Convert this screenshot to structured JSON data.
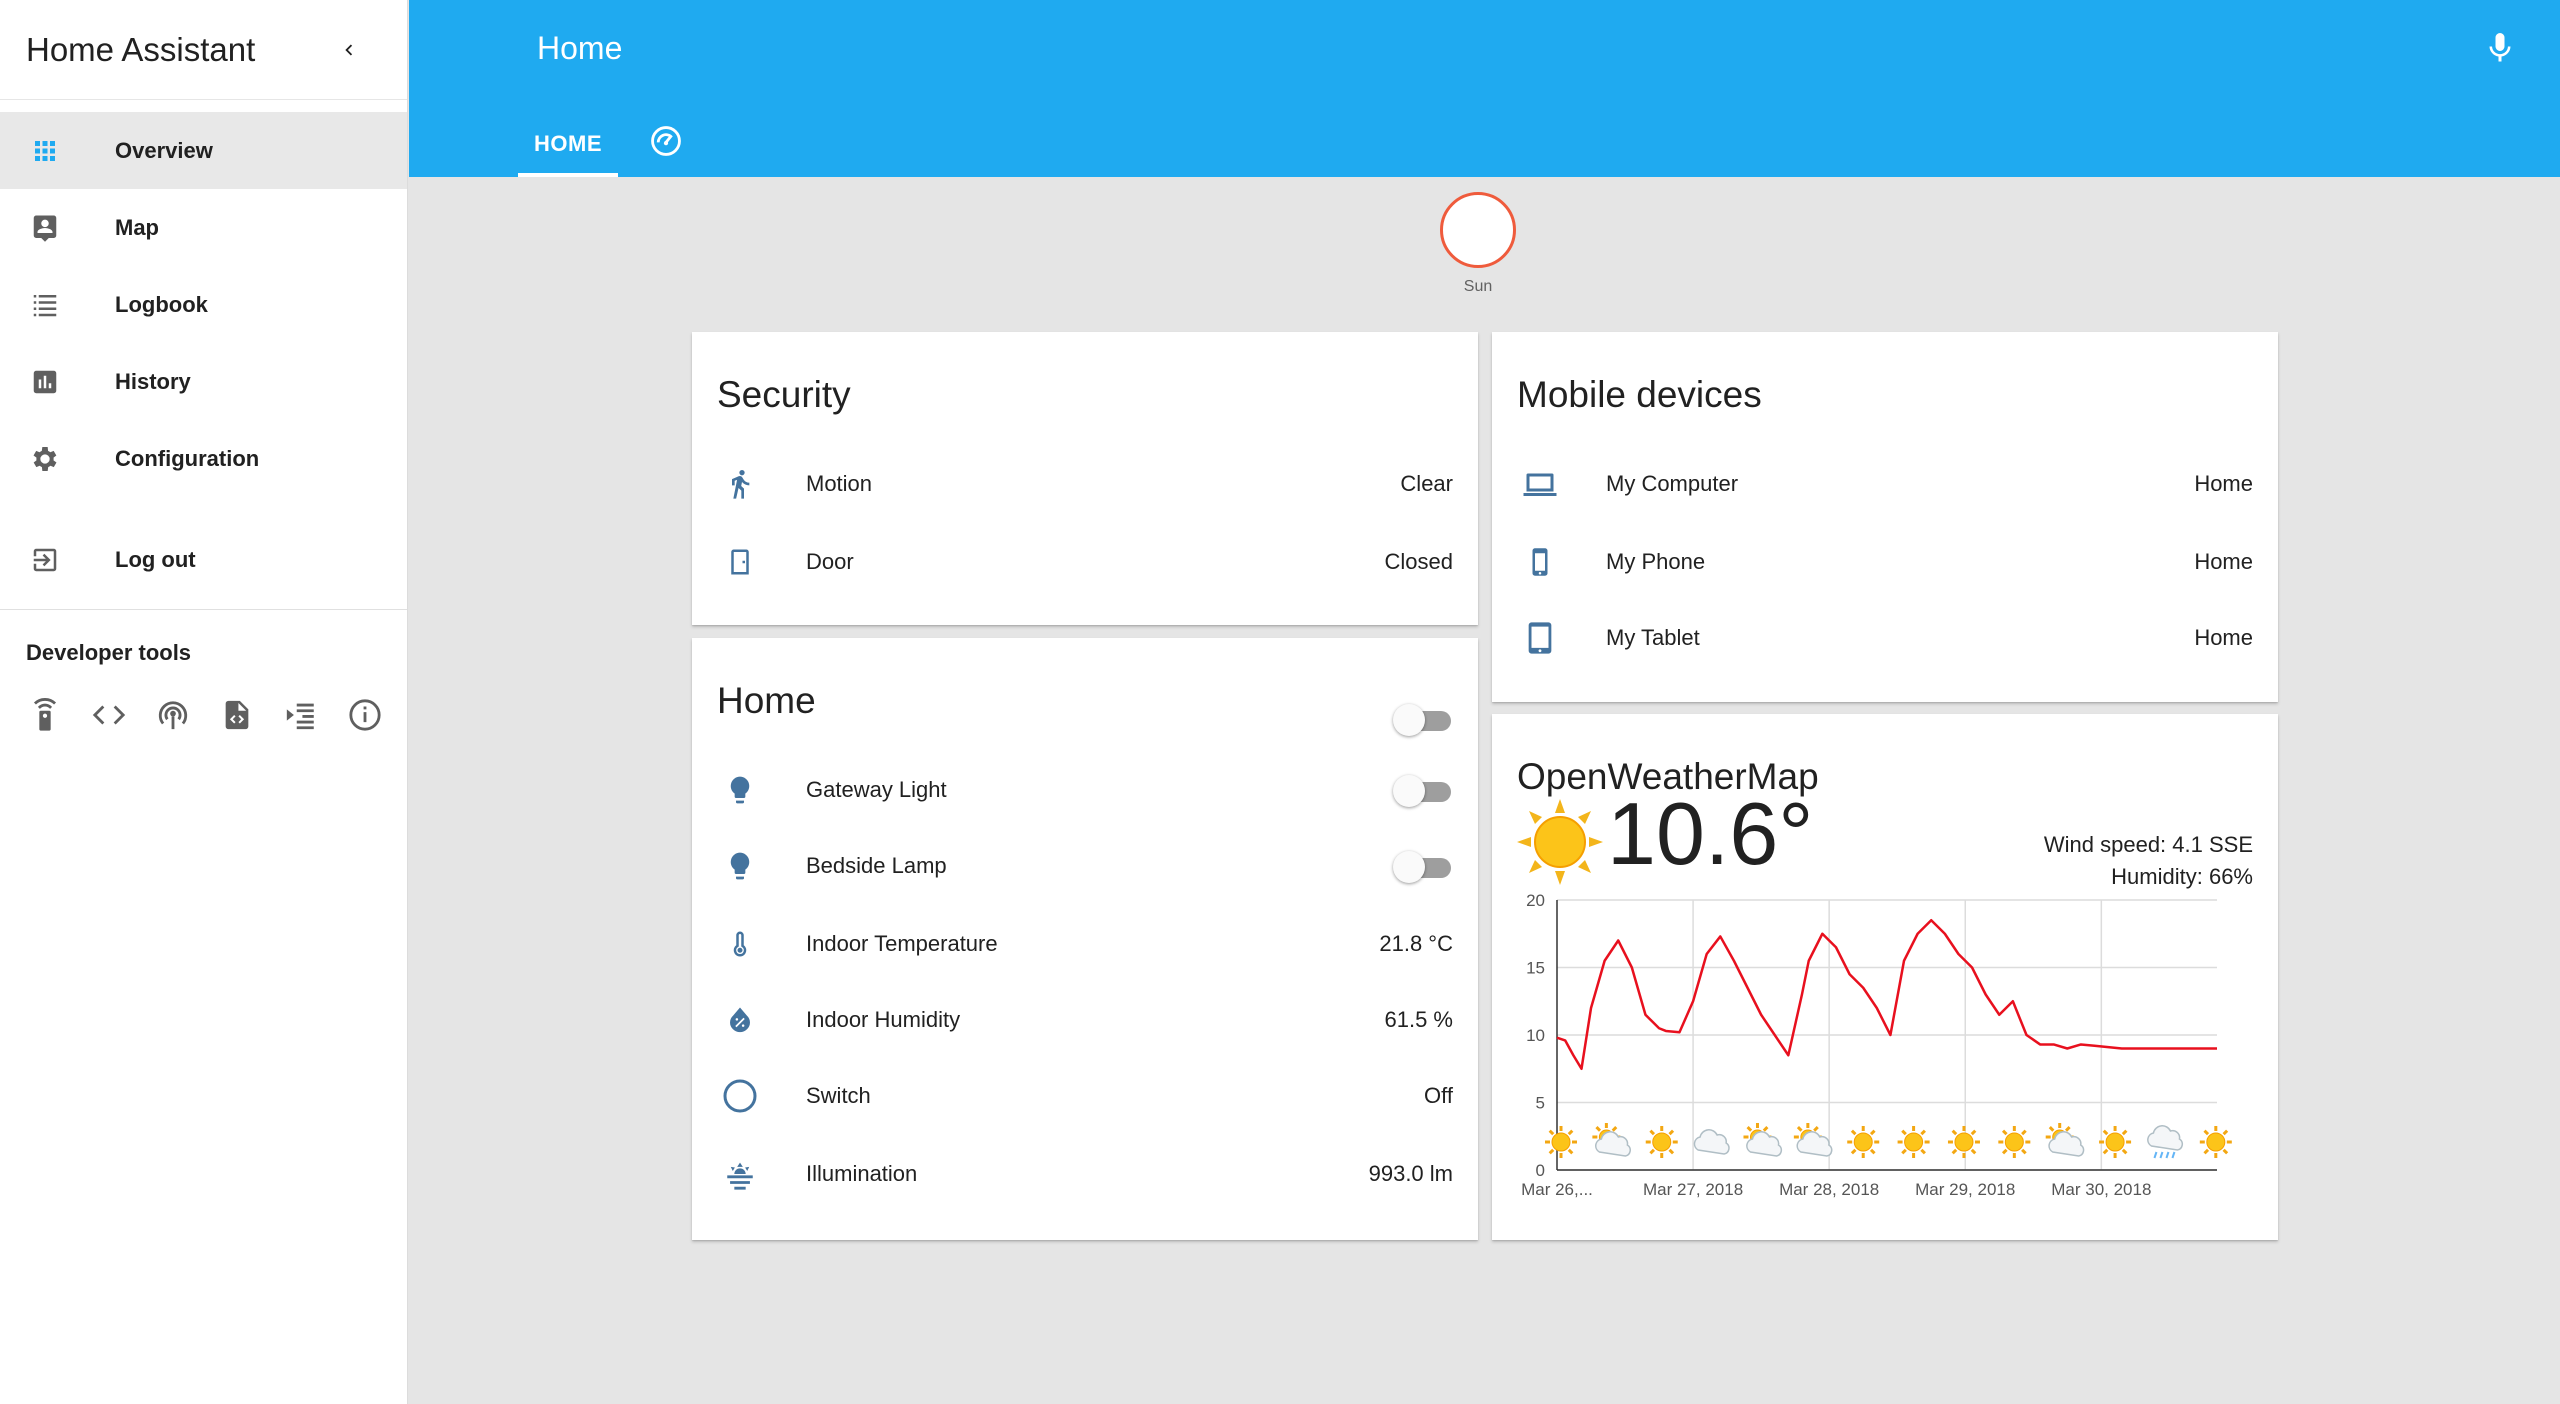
{
  "app": {
    "title": "Home Assistant"
  },
  "sidebar": {
    "items": [
      {
        "label": "Overview",
        "icon": "grid-icon",
        "active": true
      },
      {
        "label": "Map",
        "icon": "account-box-icon"
      },
      {
        "label": "Logbook",
        "icon": "list-icon"
      },
      {
        "label": "History",
        "icon": "chart-icon"
      },
      {
        "label": "Configuration",
        "icon": "gear-icon"
      },
      {
        "label": "Log out",
        "icon": "logout-icon"
      }
    ],
    "dev_tools_title": "Developer tools",
    "dev_tools_icons": [
      "remote-icon",
      "code-icon",
      "broadcast-icon",
      "file-code-icon",
      "template-icon",
      "info-icon"
    ]
  },
  "header": {
    "title": "Home",
    "tabs": [
      {
        "label": "HOME"
      },
      {
        "label": "",
        "icon": "dashboard-icon"
      }
    ]
  },
  "badge": {
    "label": "Sun",
    "icon": "moon-icon",
    "accent": "#ef5b3c"
  },
  "security": {
    "title": "Security",
    "rows": [
      {
        "name": "Motion",
        "value": "Clear",
        "icon": "walk-icon"
      },
      {
        "name": "Door",
        "value": "Closed",
        "icon": "door-icon"
      }
    ]
  },
  "home_card": {
    "title": "Home",
    "rows": [
      {
        "name": "Gateway Light",
        "icon": "bulb-icon",
        "toggle": false
      },
      {
        "name": "Bedside Lamp",
        "icon": "bulb-icon",
        "toggle": false
      },
      {
        "name": "Indoor Temperature",
        "value": "21.8 °C",
        "icon": "thermometer-icon"
      },
      {
        "name": "Indoor Humidity",
        "value": "61.5 %",
        "icon": "water-percent-icon"
      },
      {
        "name": "Switch",
        "value": "Off",
        "icon": "circle-outline-icon"
      },
      {
        "name": "Illumination",
        "value": "993.0 lm",
        "icon": "sunset-icon"
      }
    ]
  },
  "mobile": {
    "title": "Mobile devices",
    "rows": [
      {
        "name": "My Computer",
        "value": "Home",
        "icon": "laptop-icon"
      },
      {
        "name": "My Phone",
        "value": "Home",
        "icon": "phone-icon"
      },
      {
        "name": "My Tablet",
        "value": "Home",
        "icon": "tablet-icon"
      }
    ]
  },
  "weather": {
    "name": "OpenWeatherMap",
    "temperature": "10.6°",
    "wind": "Wind speed: 4.1 SSE",
    "humidity": "Humidity: 66%"
  },
  "colors": {
    "header": "#1faaf0",
    "icon": "#44739e",
    "line": "#e8101e"
  },
  "chart_data": {
    "type": "line",
    "title": "",
    "xlabel": "",
    "ylabel": "",
    "ylim": [
      0,
      20
    ],
    "yticks": [
      0,
      5,
      10,
      15,
      20
    ],
    "x_tick_labels": [
      "Mar 26,...",
      "Mar 27, 2018",
      "Mar 28, 2018",
      "Mar 29, 2018",
      "Mar 30, 2018"
    ],
    "grid": true,
    "series": [
      {
        "x": [
          0,
          0.06,
          0.12,
          0.18,
          0.25,
          0.35,
          0.45,
          0.55,
          0.65,
          0.75,
          0.8,
          0.9,
          1.0,
          1.1,
          1.2,
          1.3,
          1.4,
          1.5,
          1.6,
          1.7,
          1.8,
          1.85,
          1.95,
          2.05,
          2.15,
          2.25,
          2.35,
          2.45,
          2.55,
          2.65,
          2.75,
          2.85,
          2.95,
          3.05,
          3.15,
          3.25,
          3.35,
          3.45,
          3.55,
          3.65,
          3.75,
          3.85,
          3.95,
          4.05,
          4.15,
          4.25,
          4.35,
          4.45,
          4.55,
          4.65,
          4.75,
          4.85
        ],
        "values": [
          9.8,
          9.6,
          8.5,
          7.5,
          12.0,
          15.5,
          17.0,
          15.0,
          11.5,
          10.5,
          10.3,
          10.2,
          12.5,
          16.0,
          17.3,
          15.5,
          13.5,
          11.5,
          10.0,
          8.5,
          13.0,
          15.5,
          17.5,
          16.5,
          14.5,
          13.5,
          12.0,
          10.0,
          15.5,
          17.5,
          18.5,
          17.5,
          16.0,
          15.0,
          13.0,
          11.5,
          12.5,
          10.0,
          9.3,
          9.3,
          9.0,
          9.3,
          9.2,
          9.1,
          9.0,
          9.0,
          9.0,
          9.0,
          9.0,
          9.0,
          9.0,
          9.0
        ]
      }
    ],
    "forecast_icons": [
      "sunny",
      "partly-cloudy",
      "sunny",
      "cloudy",
      "partly-cloudy",
      "partly-cloudy",
      "sunny",
      "sunny",
      "sunny",
      "sunny",
      "partly-cloudy",
      "sunny",
      "snowy-rainy",
      "sunny"
    ]
  }
}
